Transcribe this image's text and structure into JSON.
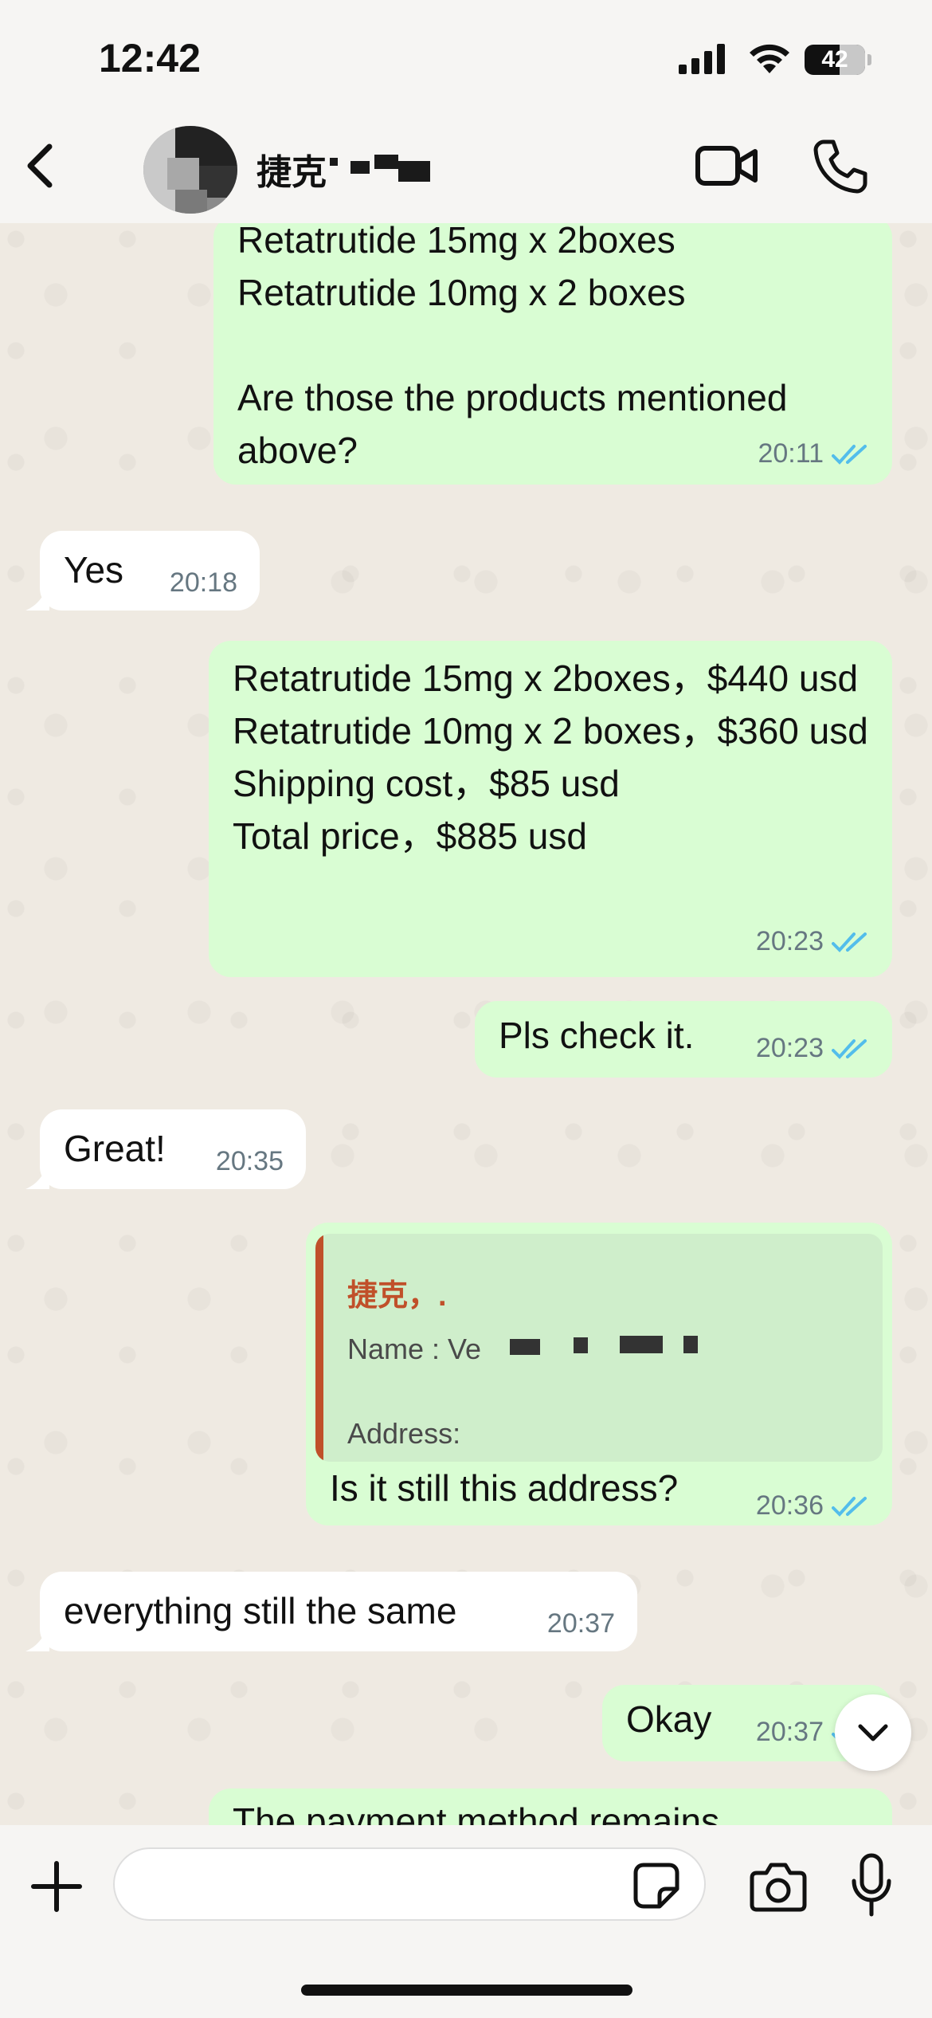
{
  "status_bar": {
    "time": "12:42",
    "battery": "42"
  },
  "header": {
    "contact_name": "捷克"
  },
  "messages": [
    {
      "dir": "out",
      "text": "Retatrutide 15mg x 2boxes\nRetatrutide 10mg x 2 boxes\n\nAre those the products mentioned above?",
      "time": "20:11",
      "read": true
    },
    {
      "dir": "in",
      "text": "Yes",
      "time": "20:18"
    },
    {
      "dir": "out",
      "text": "Retatrutide 15mg x 2boxes，$440 usd\nRetatrutide 10mg x 2 boxes，$360 usd\nShipping cost，$85 usd\nTotal price，$885 usd",
      "time": "20:23",
      "read": true
    },
    {
      "dir": "out",
      "text": "Pls check it.",
      "time": "20:23",
      "read": true
    },
    {
      "dir": "in",
      "text": "Great!",
      "time": "20:35"
    },
    {
      "dir": "out",
      "text": "Is it still this address?",
      "time": "20:36",
      "read": true,
      "quote": {
        "name": "捷克，.",
        "line1": "Name : Ve",
        "line2": "Address:"
      }
    },
    {
      "dir": "in",
      "text": "everything still the same",
      "time": "20:37"
    },
    {
      "dir": "out",
      "text": "Okay",
      "time": "20:37",
      "read": true
    },
    {
      "dir": "out",
      "text": "The payment method remains"
    }
  ],
  "composer": {
    "placeholder": ""
  },
  "colors": {
    "accent_tick": "#53bdeb",
    "outgoing": "#d9fdd3",
    "incoming": "#ffffff",
    "quote_name": "#c0502a"
  }
}
